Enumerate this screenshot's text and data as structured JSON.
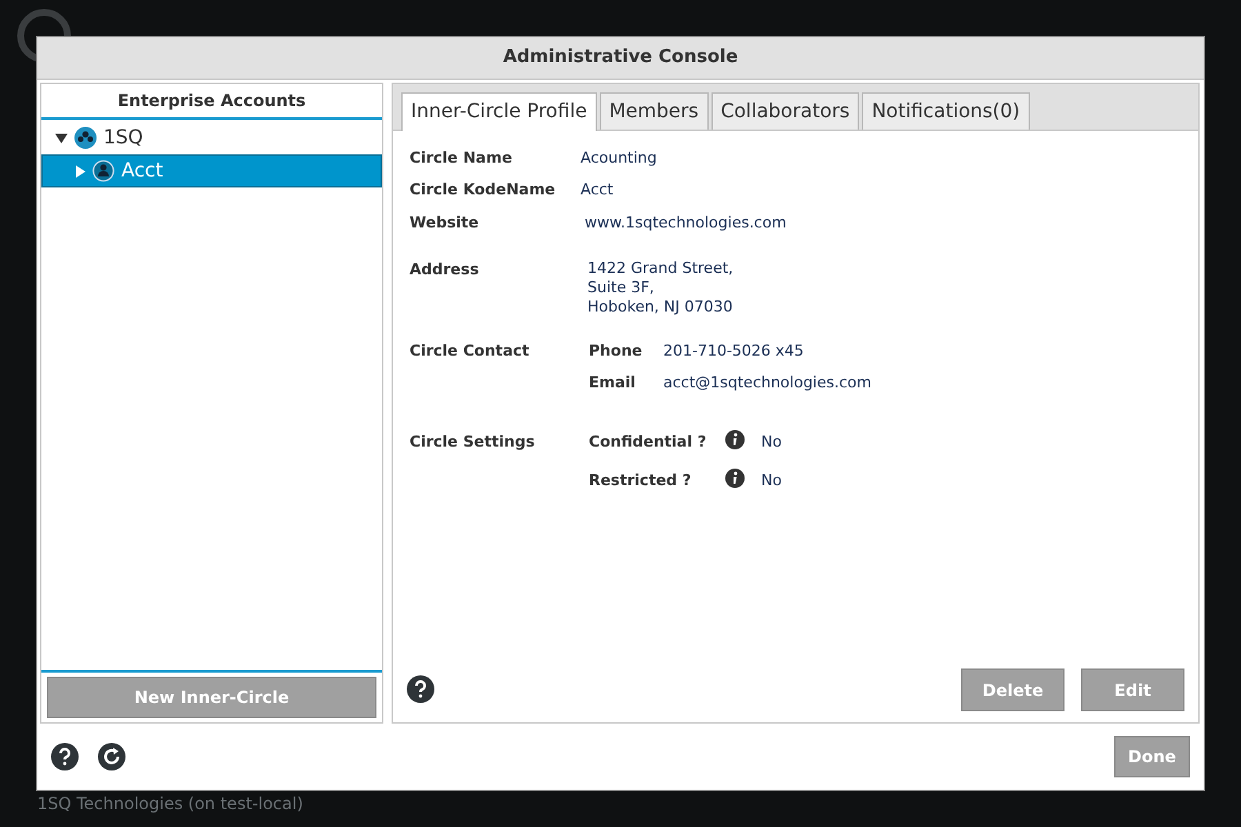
{
  "app": {
    "status": "1SQ Technologies (on test-local)"
  },
  "dialog": {
    "title": "Administrative Console",
    "sidebar": {
      "heading": "Enterprise Accounts",
      "tree": [
        {
          "label": "1SQ",
          "expanded": true,
          "selected": false,
          "children": [
            {
              "label": "Acct",
              "expanded": false,
              "selected": true
            }
          ]
        }
      ],
      "button": "New Inner-Circle"
    },
    "tabs": [
      {
        "label": "Inner-Circle Profile",
        "selected": true
      },
      {
        "label": "Members",
        "selected": false
      },
      {
        "label": "Collaborators",
        "selected": false
      },
      {
        "label": "Notifications(0)",
        "selected": false
      }
    ],
    "profile": {
      "circle_name": {
        "label": "Circle Name",
        "value": "Acounting"
      },
      "kodename": {
        "label": "Circle KodeName",
        "value": "Acct"
      },
      "website": {
        "label": "Website",
        "value": "www.1sqtechnologies.com"
      },
      "address": {
        "label": "Address",
        "lines": [
          "1422 Grand Street,",
          "Suite 3F,",
          "Hoboken, NJ 07030"
        ]
      },
      "contact": {
        "label": "Circle Contact",
        "fields": [
          {
            "label": "Phone",
            "value": "201-710-5026 x45"
          },
          {
            "label": "Email",
            "value": "acct@1sqtechnologies.com"
          }
        ]
      },
      "settings": {
        "label": "Circle Settings",
        "fields": [
          {
            "label": "Confidential ?",
            "value": "No"
          },
          {
            "label": "Restricted ?",
            "value": "No"
          }
        ]
      }
    },
    "actions": [
      "Delete",
      "Edit"
    ],
    "footer_button": "Done"
  }
}
